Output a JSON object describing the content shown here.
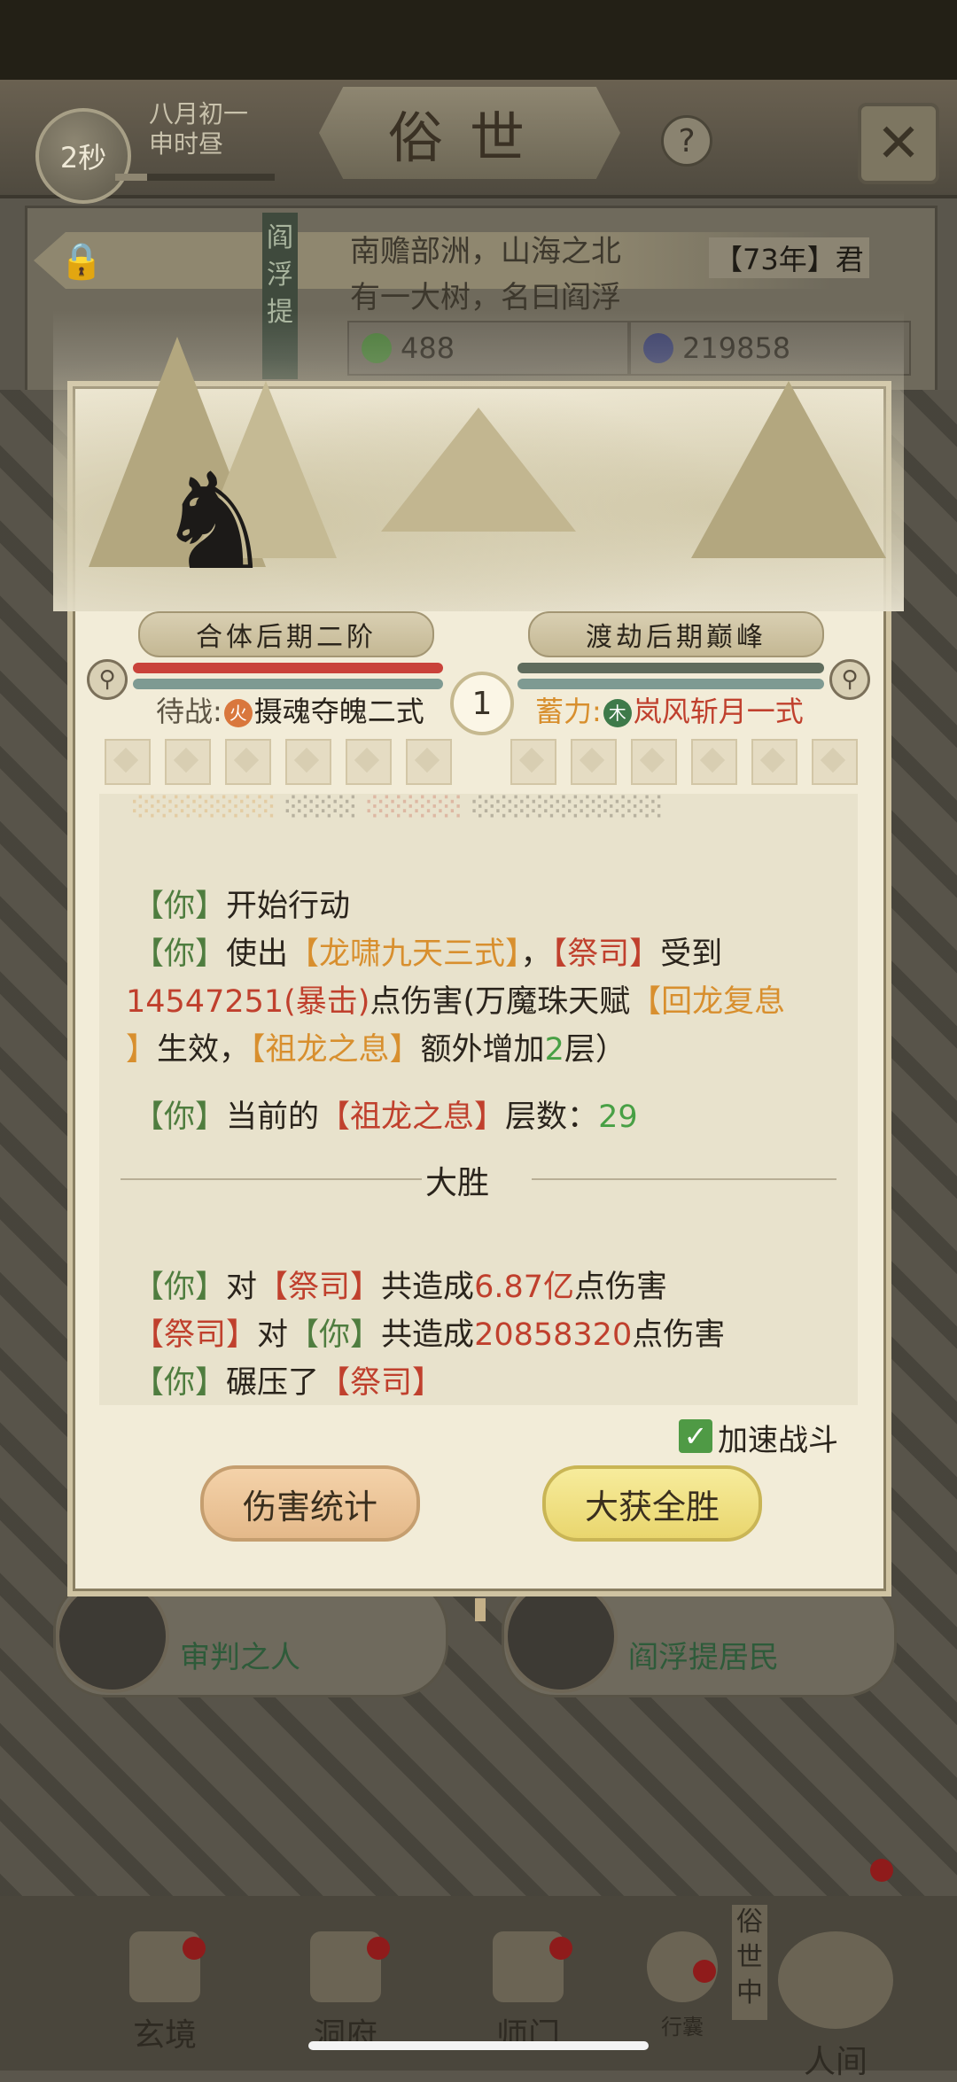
{
  "header": {
    "timer": "2秒",
    "date_line1": "八月初一",
    "date_line2": "申时昼",
    "title": "俗世",
    "help_symbol": "?",
    "close_symbol": "✕"
  },
  "location": {
    "line1": "南赡部洲，山海之北",
    "line2": "有一大树，名曰阎浮",
    "year": "【73年】君",
    "side_label": "阎浮提",
    "res_spirit": "488",
    "res_stone": "219858"
  },
  "npcs": [
    {
      "name": "审判之人"
    },
    {
      "name": "阎浮提居民"
    }
  ],
  "battle": {
    "left_realm": "合体后期二阶",
    "right_realm": "渡劫后期巅峰",
    "round": "1",
    "left_status_prefix": "待战:",
    "left_elem": "火",
    "left_skill": "摄魂夺魄二式",
    "right_status_prefix": "蓄力:",
    "right_elem": "木",
    "right_skill": "岚风斩月一式",
    "divider": "大胜",
    "speed_label": "加速战斗",
    "btn_stats": "伤害统计",
    "btn_win": "大获全胜",
    "colors": {
      "left_hp": "#c9423a",
      "right_hp": "#5f6c5d",
      "mp": "#7e9a92"
    }
  },
  "log": {
    "l1_you": "【你】",
    "l1_text": "开始行动",
    "l2_you": "【你】",
    "l2_a": "使出",
    "l2_skill": "【龙啸九天三式】",
    "l2_b": "，",
    "l2_enemy": "【祭司】",
    "l2_c": "受到",
    "l3_dmg": "14547251(暴击)",
    "l3_a": "点伤害(万魔珠天赋",
    "l3_skill": "【回龙复息",
    "l4_skill": "】",
    "l4_a": "生效，",
    "l4_skill2": "【祖龙之息】",
    "l4_b": "额外增加",
    "l4_num": "2",
    "l4_c": "层）",
    "l5_you": "【你】",
    "l5_a": "当前的",
    "l5_skill": "【祖龙之息】",
    "l5_b": "层数：",
    "l5_num": "29",
    "s1_you": "【你】",
    "s1_a": "对",
    "s1_enemy": "【祭司】",
    "s1_b": "共造成",
    "s1_num": "6.87亿",
    "s1_c": "点伤害",
    "s2_enemy": "【祭司】",
    "s2_a": "对",
    "s2_you": "【你】",
    "s2_b": "共造成",
    "s2_num": "20858320",
    "s2_c": "点伤害",
    "s3_you": "【你】",
    "s3_a": "碾压了",
    "s3_enemy": "【祭司】"
  },
  "nav": {
    "items": [
      "玄境",
      "洞府",
      "师门",
      "行囊",
      "人间"
    ],
    "side_label": "俗世中"
  }
}
